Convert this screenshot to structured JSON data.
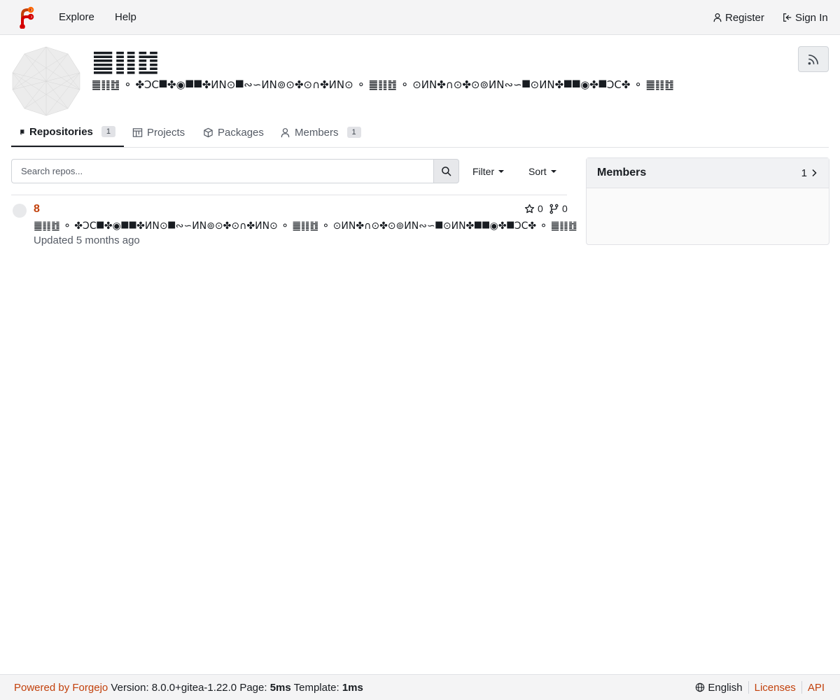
{
  "navbar": {
    "explore": "Explore",
    "help": "Help",
    "register": "Register",
    "sign_in": "Sign In"
  },
  "org": {
    "title": "䷀䷁䷂",
    "description": "䷀䷁䷂ ⚬ ✤ↃϹ⯀✤◉⯀⯀✤ИΝ⊙⯀∾∽ИΝ⊚⊙✤⊙∩✤ИΝ⊙ ⚬ ䷀䷁䷂ ⚬ ⊙ИΝ✤∩⊙✤⊙⊚ИΝ∾∽⯀⊙ИΝ✤⯀⯀◉✤⯀ↃϹ✤ ⚬ ䷀䷁䷂"
  },
  "tabs": {
    "repositories": "Repositories",
    "repositories_count": "1",
    "projects": "Projects",
    "packages": "Packages",
    "members": "Members",
    "members_count": "1"
  },
  "search": {
    "placeholder": "Search repos...",
    "filter": "Filter",
    "sort": "Sort"
  },
  "repos": [
    {
      "name": "8",
      "stars": "0",
      "forks": "0",
      "description": "䷀䷁䷂ ⚬ ✤ↃϹ⯀✤◉⯀⯀✤ИΝ⊙⯀∾∽ИΝ⊚⊙✤⊙∩✤ИΝ⊙ ⚬ ䷀䷁䷂ ⚬ ⊙ИΝ✤∩⊙✤⊙⊚ИΝ∾∽⯀⊙ИΝ✤⯀⯀◉✤⯀ↃϹ✤ ⚬ ䷀䷁䷂",
      "updated": "Updated 5 months ago"
    }
  ],
  "members_panel": {
    "title": "Members",
    "count": "1"
  },
  "footer": {
    "powered_by": "Powered by Forgejo",
    "version": "Version: 8.0.0+gitea-1.22.0",
    "page_label": "Page:",
    "page_time": "5ms",
    "template_label": "Template:",
    "template_time": "1ms",
    "language": "English",
    "licenses": "Licenses",
    "api": "API"
  },
  "colors": {
    "accent": "#c2410c",
    "navbar_bg": "#f4f4f5",
    "text": "#181c21"
  }
}
